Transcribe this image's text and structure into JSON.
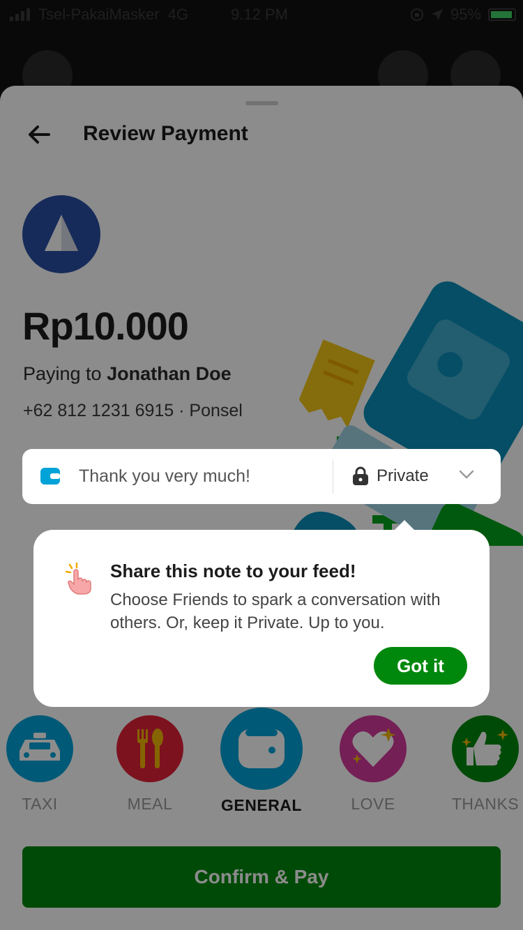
{
  "status_bar": {
    "carrier": "Tsel-PakaiMasker",
    "network": "4G",
    "time": "9.12 PM",
    "battery": "95%"
  },
  "header": {
    "title": "Review Payment"
  },
  "payment": {
    "amount": "Rp10.000",
    "paying_prefix": "Paying to",
    "recipient": "Jonathan Doe",
    "phone": "+62 812 1231 6915",
    "separator": "·",
    "phone_type": "Ponsel"
  },
  "note": {
    "text": "Thank you very much!",
    "privacy": "Private"
  },
  "tooltip": {
    "title": "Share this note to your feed!",
    "body": "Choose Friends to spark a conversation with others. Or, keep it Private. Up to you.",
    "button": "Got it"
  },
  "categories": [
    {
      "label": "TAXI",
      "icon": "taxi-icon",
      "color": "#00a3d8",
      "selected": false
    },
    {
      "label": "MEAL",
      "icon": "meal-icon",
      "color": "#e4223a",
      "selected": false
    },
    {
      "label": "GENERAL",
      "icon": "wallet-icon",
      "color": "#00a3d8",
      "selected": true
    },
    {
      "label": "LOVE",
      "icon": "heart-icon",
      "color": "#d43a9c",
      "selected": false
    },
    {
      "label": "THANKS",
      "icon": "thumbs-up-icon",
      "color": "#00880d",
      "selected": false
    }
  ],
  "confirm_button": "Confirm & Pay",
  "colors": {
    "brand_green": "#00880d",
    "accent_blue": "#00a3d8",
    "avatar_blue": "#2a4fa5"
  }
}
